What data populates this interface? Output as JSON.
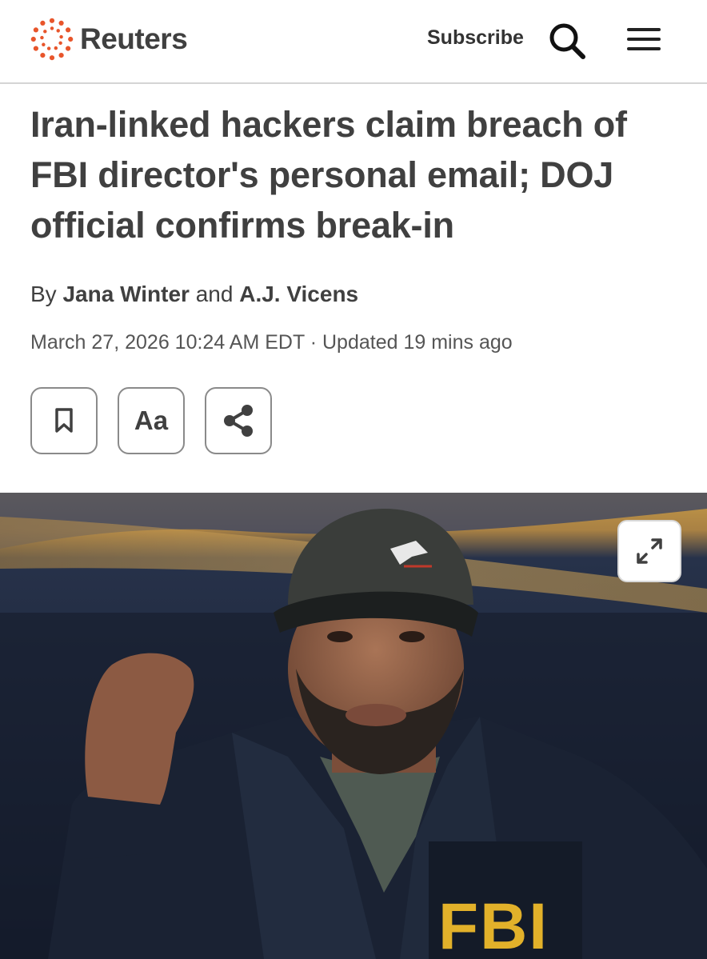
{
  "header": {
    "brand": "Reuters",
    "subscribe_label": "Subscribe",
    "icons": [
      "reuters-logo-icon",
      "search-icon",
      "menu-icon"
    ]
  },
  "article": {
    "headline": "Iran-linked hackers claim breach of FBI director's personal email; DOJ official confirms break-in",
    "byline": {
      "prefix": "By",
      "author1": "Jana Winter",
      "conjunction": "and",
      "author2": "A.J. Vicens"
    },
    "dateline": "March 27, 2026 10:24 AM EDT · Updated 19 mins ago",
    "tools": {
      "bookmark_icon": "bookmark-icon",
      "text_size_label": "Aa",
      "share_icon": "share-icon"
    },
    "image": {
      "jacket_text": "FBI",
      "expand_icon": "expand-icon"
    }
  },
  "colors": {
    "brand_orange": "#e8552b",
    "text": "#404040",
    "divider": "#d4d4d4",
    "fbi_yellow": "#e2b12a"
  }
}
